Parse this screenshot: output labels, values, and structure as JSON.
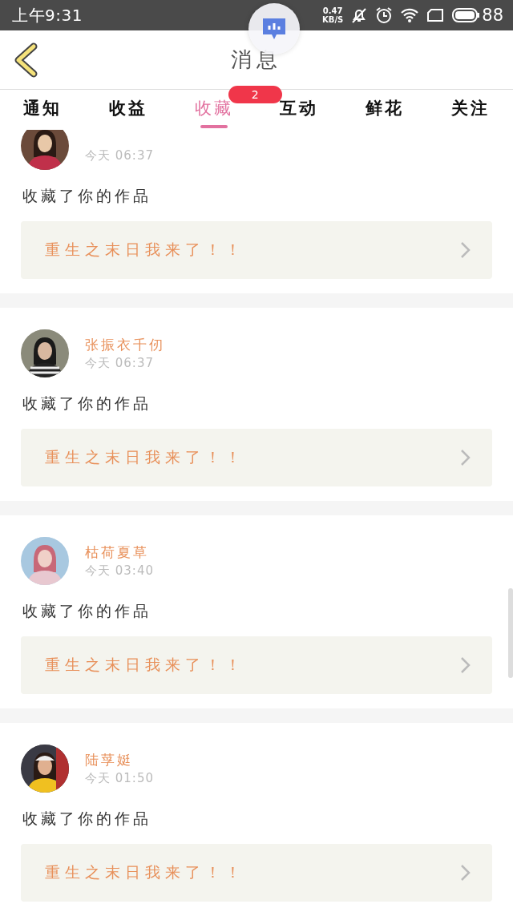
{
  "status_bar": {
    "time": "上午9:31",
    "speed": {
      "value": "0.47",
      "unit": "KB/S"
    },
    "battery": "88"
  },
  "header": {
    "title": "消息"
  },
  "tabs": [
    {
      "label": "通知",
      "selected": false
    },
    {
      "label": "收益",
      "selected": false
    },
    {
      "label": "收藏",
      "selected": true,
      "badge": "2"
    },
    {
      "label": "互动",
      "selected": false
    },
    {
      "label": "鲜花",
      "selected": false
    },
    {
      "label": "关注",
      "selected": false
    }
  ],
  "notifications": [
    {
      "time": "今天 06:37",
      "action": "收藏了你的作品",
      "work_title": "重生之末日我来了！！"
    },
    {
      "name": "张振衣千仞",
      "time": "今天 06:37",
      "action": "收藏了你的作品",
      "work_title": "重生之末日我来了！！"
    },
    {
      "name": "枯荷夏草",
      "time": "今天 03:40",
      "action": "收藏了你的作品",
      "work_title": "重生之末日我来了！！"
    },
    {
      "name": "陆莩娗",
      "time": "今天 01:50",
      "action": "收藏了你的作品",
      "work_title": "重生之末日我来了！！"
    }
  ]
}
